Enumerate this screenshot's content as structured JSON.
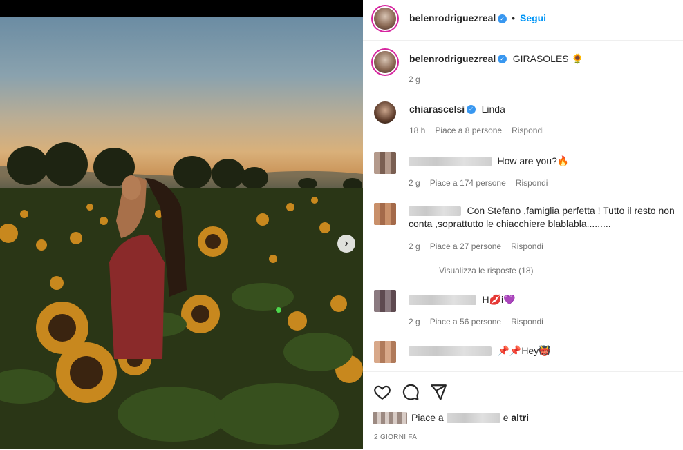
{
  "post": {
    "author": "belenrodriguezreal",
    "follow_label": "Segui",
    "caption": "GIRASOLES 🌻",
    "caption_time": "2 g"
  },
  "comments": [
    {
      "user": "chiarascelsi",
      "text": "Linda",
      "time": "18 h",
      "likes": "Piace a 8 persone",
      "reply": "Rispondi"
    },
    {
      "user": "",
      "text": "How are you?🔥",
      "time": "2 g",
      "likes": "Piace a 174 persone",
      "reply": "Rispondi"
    },
    {
      "user": "",
      "text": "Con Stefano ,famiglia perfetta ! Tutto il resto non conta ,soprattutto le chiacchiere blablabla.........",
      "time": "2 g",
      "likes": "Piace a 27 persone",
      "reply": "Rispondi",
      "replies_label": "Visualizza le risposte (18)"
    },
    {
      "user": "",
      "text": "H💋i💜",
      "time": "2 g",
      "likes": "Piace a 56 persone",
      "reply": "Rispondi"
    },
    {
      "user": "",
      "text": "📌📌Hey👹",
      "time": "",
      "likes": "",
      "reply": ""
    }
  ],
  "footer": {
    "likes_prefix": "Piace a",
    "likes_suffix": "e",
    "likes_others": "altri",
    "time_ago": "2 GIORNI FA"
  },
  "icons": {
    "like": "heart-icon",
    "comment": "comment-icon",
    "share": "send-icon",
    "next": "chevron-right-icon"
  },
  "colors": {
    "verified": "#3897f0",
    "follow": "#0095f6"
  }
}
